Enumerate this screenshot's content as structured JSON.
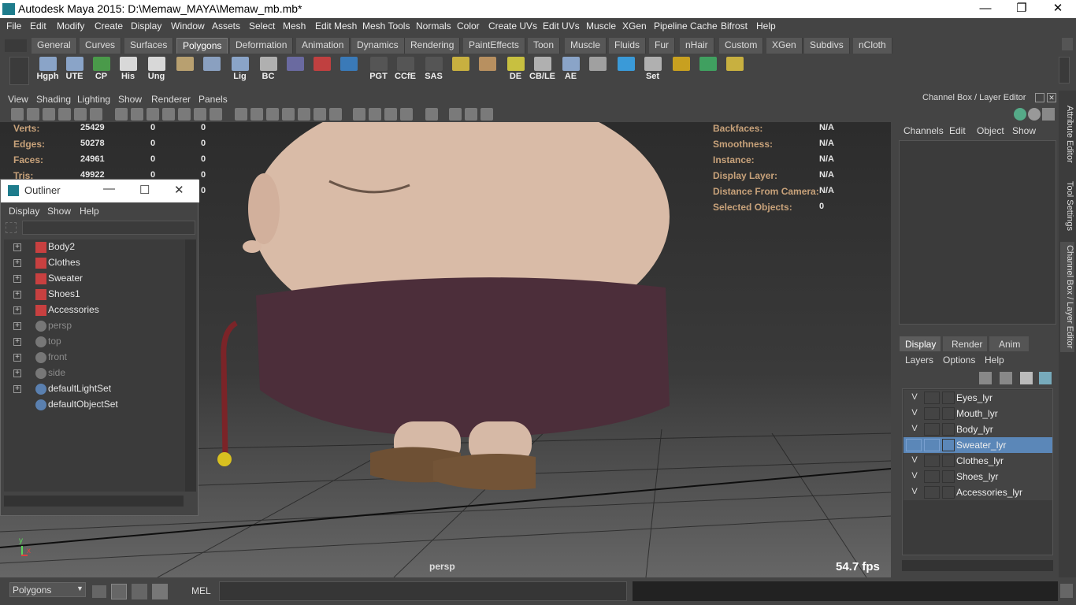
{
  "window": {
    "title": "Autodesk Maya 2015: D:\\Memaw_MAYA\\Memaw_mb.mb*",
    "minimize": "—",
    "maximize": "❐",
    "close": "✕"
  },
  "menus": [
    "File",
    "Edit",
    "Modify",
    "Create",
    "Display",
    "Window",
    "Assets",
    "Select",
    "Mesh",
    "Edit Mesh",
    "Mesh Tools",
    "Normals",
    "Color",
    "Create UVs",
    "Edit UVs",
    "Muscle",
    "XGen",
    "Pipeline Cache",
    "Bifrost",
    "Help"
  ],
  "shelf_tabs": [
    "General",
    "Curves",
    "Surfaces",
    "Polygons",
    "Deformation",
    "Animation",
    "Dynamics",
    "Rendering",
    "PaintEffects",
    "Toon",
    "Muscle",
    "Fluids",
    "Fur",
    "nHair",
    "Custom",
    "XGen",
    "Subdivs",
    "nCloth"
  ],
  "shelf_active": "Polygons",
  "shelf_icons": [
    {
      "label": "Hgph",
      "color": "#8aa4c8"
    },
    {
      "label": "UTE",
      "color": "#8aa4c8"
    },
    {
      "label": "CP",
      "color": "#4a9a4a"
    },
    {
      "label": "His",
      "color": "#d8d8d8"
    },
    {
      "label": "Ung",
      "color": "#d8d8d8"
    },
    {
      "label": "",
      "color": "#b8a070"
    },
    {
      "label": "",
      "color": "#8aa0c0"
    },
    {
      "label": "Lig",
      "color": "#8aa4c8"
    },
    {
      "label": "BC",
      "color": "#b0b0b0"
    },
    {
      "label": "",
      "color": "#6a6aa0"
    },
    {
      "label": "",
      "color": "#c04040"
    },
    {
      "label": "",
      "color": "#3a7ab8"
    },
    {
      "label": "PGT",
      "color": "#555"
    },
    {
      "label": "CCfE",
      "color": "#555"
    },
    {
      "label": "SAS",
      "color": "#555"
    },
    {
      "label": "",
      "color": "#c8b040"
    },
    {
      "label": "",
      "color": "#b89060"
    },
    {
      "label": "DE",
      "color": "#c8c040"
    },
    {
      "label": "CB/LE",
      "color": "#b0b0b0"
    },
    {
      "label": "AE",
      "color": "#8aa4c8"
    },
    {
      "label": "",
      "color": "#a0a0a0"
    },
    {
      "label": "",
      "color": "#3a9ad8"
    },
    {
      "label": "Set",
      "color": "#b0b0b0"
    },
    {
      "label": "",
      "color": "#c8a020"
    },
    {
      "label": "",
      "color": "#40a060"
    },
    {
      "label": "",
      "color": "#c8b040"
    }
  ],
  "panel_menu": [
    "View",
    "Shading",
    "Lighting",
    "Show",
    "Renderer",
    "Panels"
  ],
  "hud_left": [
    {
      "label": "Verts:",
      "v1": "25429",
      "v2": "0",
      "v3": "0"
    },
    {
      "label": "Edges:",
      "v1": "50278",
      "v2": "0",
      "v3": "0"
    },
    {
      "label": "Faces:",
      "v1": "24961",
      "v2": "0",
      "v3": "0"
    },
    {
      "label": "Tris:",
      "v1": "49922",
      "v2": "0",
      "v3": "0"
    },
    {
      "label": "",
      "v1": "",
      "v2": "",
      "v3": "0"
    }
  ],
  "hud_right": [
    {
      "label": "Backfaces:",
      "value": "N/A"
    },
    {
      "label": "Smoothness:",
      "value": "N/A"
    },
    {
      "label": "Instance:",
      "value": "N/A"
    },
    {
      "label": "Display Layer:",
      "value": "N/A"
    },
    {
      "label": "Distance From Camera:",
      "value": "N/A"
    },
    {
      "label": "Selected Objects:",
      "value": "0"
    }
  ],
  "viewport": {
    "camera": "persp",
    "fps": "54.7 fps",
    "axis_x": "x",
    "axis_y": "y"
  },
  "outliner": {
    "title": "Outliner",
    "menus": [
      "Display",
      "Show",
      "Help"
    ],
    "items": [
      {
        "label": "Body2",
        "type": "layer",
        "dim": false,
        "expand": true
      },
      {
        "label": "Clothes",
        "type": "layer",
        "dim": false,
        "expand": true
      },
      {
        "label": "Sweater",
        "type": "layer",
        "dim": false,
        "expand": true
      },
      {
        "label": "Shoes1",
        "type": "layer",
        "dim": false,
        "expand": true
      },
      {
        "label": "Accessories",
        "type": "layer",
        "dim": false,
        "expand": true
      },
      {
        "label": "persp",
        "type": "camera",
        "dim": true,
        "expand": true
      },
      {
        "label": "top",
        "type": "camera",
        "dim": true,
        "expand": true
      },
      {
        "label": "front",
        "type": "camera",
        "dim": true,
        "expand": true
      },
      {
        "label": "side",
        "type": "camera",
        "dim": true,
        "expand": true
      },
      {
        "label": "defaultLightSet",
        "type": "set",
        "dim": false,
        "expand": true
      },
      {
        "label": "defaultObjectSet",
        "type": "set",
        "dim": false,
        "expand": false
      }
    ]
  },
  "channel_box": {
    "title": "Channel Box / Layer Editor",
    "menus": [
      "Channels",
      "Edit",
      "Object",
      "Show"
    ]
  },
  "layer_editor": {
    "tabs": [
      "Display",
      "Render",
      "Anim"
    ],
    "menus": [
      "Layers",
      "Options",
      "Help"
    ],
    "layers": [
      {
        "v": "V",
        "name": "Eyes_lyr",
        "selected": false
      },
      {
        "v": "V",
        "name": "Mouth_lyr",
        "selected": false
      },
      {
        "v": "V",
        "name": "Body_lyr",
        "selected": false
      },
      {
        "v": "",
        "name": "Sweater_lyr",
        "selected": true
      },
      {
        "v": "V",
        "name": "Clothes_lyr",
        "selected": false
      },
      {
        "v": "V",
        "name": "Shoes_lyr",
        "selected": false
      },
      {
        "v": "V",
        "name": "Accessories_lyr",
        "selected": false
      }
    ]
  },
  "side_tabs": [
    "Attribute Editor",
    "Tool Settings",
    "Channel Box / Layer Editor"
  ],
  "bottom": {
    "menu_set": "Polygons",
    "mel": "MEL"
  }
}
